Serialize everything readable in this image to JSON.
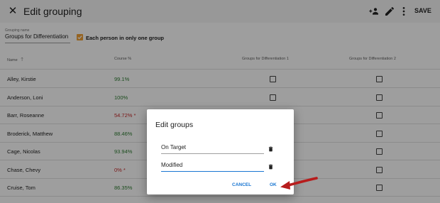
{
  "appbar": {
    "title": "Edit grouping",
    "save_label": "SAVE",
    "icons": [
      "close-icon",
      "add-group-icon",
      "pencil-icon",
      "more-vert-icon"
    ]
  },
  "form": {
    "grouping_label": "Grouping name",
    "grouping_value": "Groups for Differentiation",
    "one_group_checked": true,
    "one_group_label": "Each person in only one group"
  },
  "table": {
    "headers": {
      "name": "Name",
      "course": "Course %",
      "group1": "Groups for Differentiation 1",
      "group2": "Groups for Differentiation 2"
    },
    "sort_icon": "arrow-up-icon",
    "rows": [
      {
        "name": "Alley, Kirstie",
        "pct": "99.1%",
        "status": "green"
      },
      {
        "name": "Anderson, Loni",
        "pct": "100%",
        "status": "green"
      },
      {
        "name": "Barr, Roseanne",
        "pct": "54.72% *",
        "status": "red"
      },
      {
        "name": "Broderick, Matthew",
        "pct": "88.46%",
        "status": "green"
      },
      {
        "name": "Cage, Nicolas",
        "pct": "93.94%",
        "status": "green"
      },
      {
        "name": "Chase, Chevy",
        "pct": "0% *",
        "status": "red"
      },
      {
        "name": "Cruise, Tom",
        "pct": "86.35%",
        "status": "green"
      }
    ]
  },
  "dialog": {
    "title": "Edit groups",
    "group_names": [
      "On Target",
      "Modified"
    ],
    "cancel_label": "CANCEL",
    "ok_label": "OK",
    "delete_icon": "trash-icon"
  },
  "colors": {
    "accent": "#1976d2",
    "checkbox_orange": "#f0a035",
    "good": "#2e7d32",
    "bad": "#c62828",
    "arrow": "#b71c1c"
  }
}
